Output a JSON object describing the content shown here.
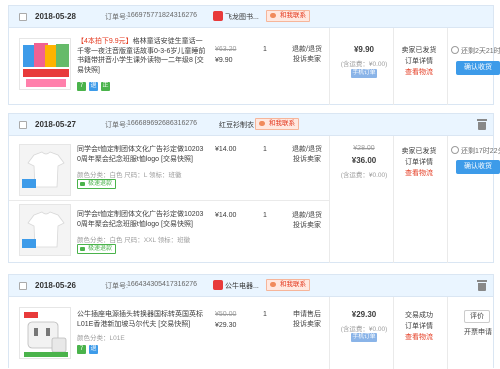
{
  "labels": {
    "order_no": "订单号:",
    "chat": "和我联系",
    "after_sale": "退款/退货",
    "complain": "投诉卖家",
    "freight": "(含运费：¥0.00)",
    "mobile_order": "手机订单",
    "seller_shipped": "卖家已发货",
    "order_detail": "订单详情",
    "view_logistics": "查看物流",
    "confirm_receipt": "确认收货",
    "review": "评价",
    "reopen_invoice": "开票申请",
    "trade_success": "交易成功",
    "tag_seven": "7",
    "tag_refund": "退",
    "tag_zheng": "正",
    "refund_badge": "极速退款"
  },
  "orders": [
    {
      "date": "2018-05-28",
      "order_no": "166975771824316276",
      "shop": "飞龙图书...",
      "items": [
        {
          "title_hl": "【4本拍下9.9元】",
          "title": "格林童话安徒生童话一千零一夜注音版童话故事0-3-6岁儿童睡前书籍带拼音小学生课外读物一二年级8 [交易快照]",
          "orig_price": "¥63.20",
          "unit_price": "¥9.90",
          "qty": "1"
        }
      ],
      "total": "¥9.90",
      "countdown": "还剩2天21时40分"
    },
    {
      "date": "2018-05-27",
      "order_no": "166689692686316276",
      "shop": "红豆衫制衣",
      "items": [
        {
          "title": "同学会t恤定制团体文化广告衫定做10203 0周年聚会纪念班服t恤logo [交易快照]",
          "spec": "颜色分类：白色  尺码：L  领标：班徽",
          "unit_price": "¥14.00",
          "qty": "1"
        },
        {
          "title": "同学会t恤定制团体文化广告衫定做10203 0周年聚会纪念班服t恤logo [交易快照]",
          "spec": "颜色分类：白色  尺码：XXL  领标：班徽",
          "unit_price": "¥14.00",
          "qty": "1"
        }
      ],
      "orig_total": "¥28.00",
      "total": "¥36.00",
      "countdown": "还剩17时22分"
    },
    {
      "date": "2018-05-26",
      "order_no": "166434305417316276",
      "shop": "公牛电器...",
      "items": [
        {
          "title": "公牛插座电源插头转换器国标转英国英标 L01E香港新加坡马尔代夫 [交易快照]",
          "spec": "颜色分类：L01E",
          "orig_price": "¥50.00",
          "unit_price": "¥29.30",
          "qty": "1"
        }
      ],
      "total": "¥29.30",
      "after_sale": "申请售后",
      "complain": "投诉卖家"
    }
  ],
  "colors": {
    "header_bg": "#eaf5ff",
    "accent_blue": "#3d9be9",
    "accent_red": "#e4391f",
    "green": "#4ab34b"
  },
  "icons": {
    "checkbox": "checkbox",
    "shop": "shop-icon",
    "chat": "chat-icon",
    "trash": "trash-icon",
    "clock": "clock-icon"
  }
}
